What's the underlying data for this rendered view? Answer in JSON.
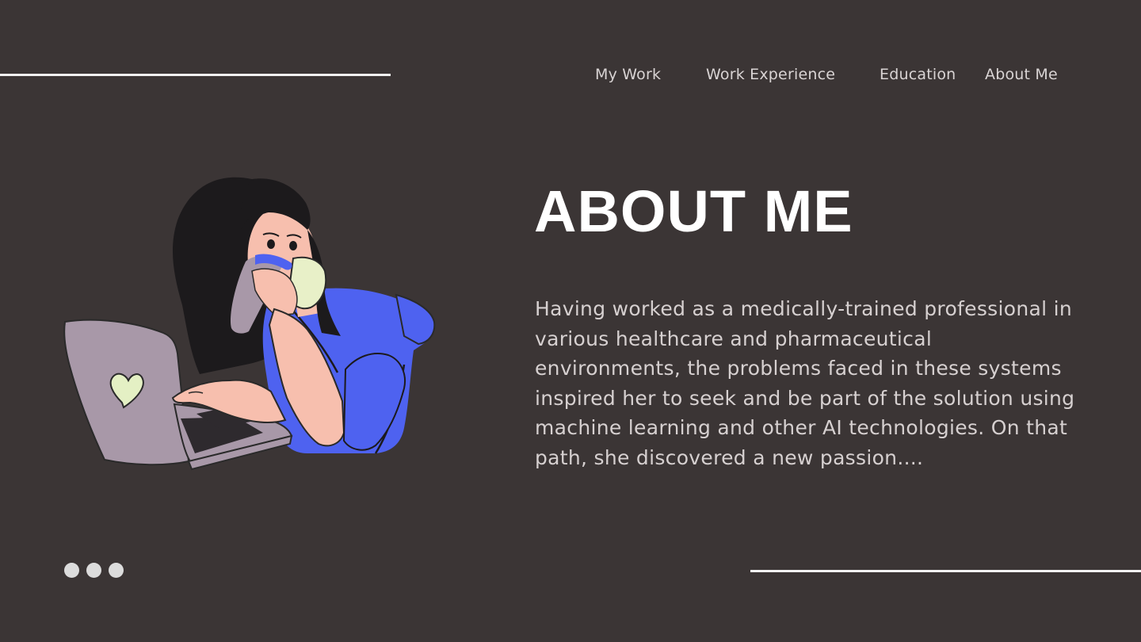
{
  "nav": {
    "items": [
      {
        "label": "My Work"
      },
      {
        "label": "Work Experience"
      },
      {
        "label": "Education"
      },
      {
        "label": "About Me"
      }
    ]
  },
  "main": {
    "title": "ABOUT ME",
    "description": "Having worked as a medically-trained professional in various healthcare and pharmaceutical environments, the problems faced in these systems inspired her to seek and be part of the solution using machine learning and other AI technologies. On that path, she discovered a new passion...."
  },
  "illustration": {
    "icon": "woman-drinking-at-laptop-illustration",
    "colors": {
      "shirt": "#4e62f0",
      "laptop": "#a898a8",
      "skin": "#f7bfae",
      "hair": "#1c1a1c",
      "mask": "#e8f0c8",
      "heart": "#e4f0c4"
    }
  },
  "pagination": {
    "icon": "ellipsis-dots-icon"
  },
  "colors": {
    "background": "#3b3535",
    "text": "#d6d0d0",
    "title": "#ffffff",
    "rule": "#f2f2f2"
  }
}
